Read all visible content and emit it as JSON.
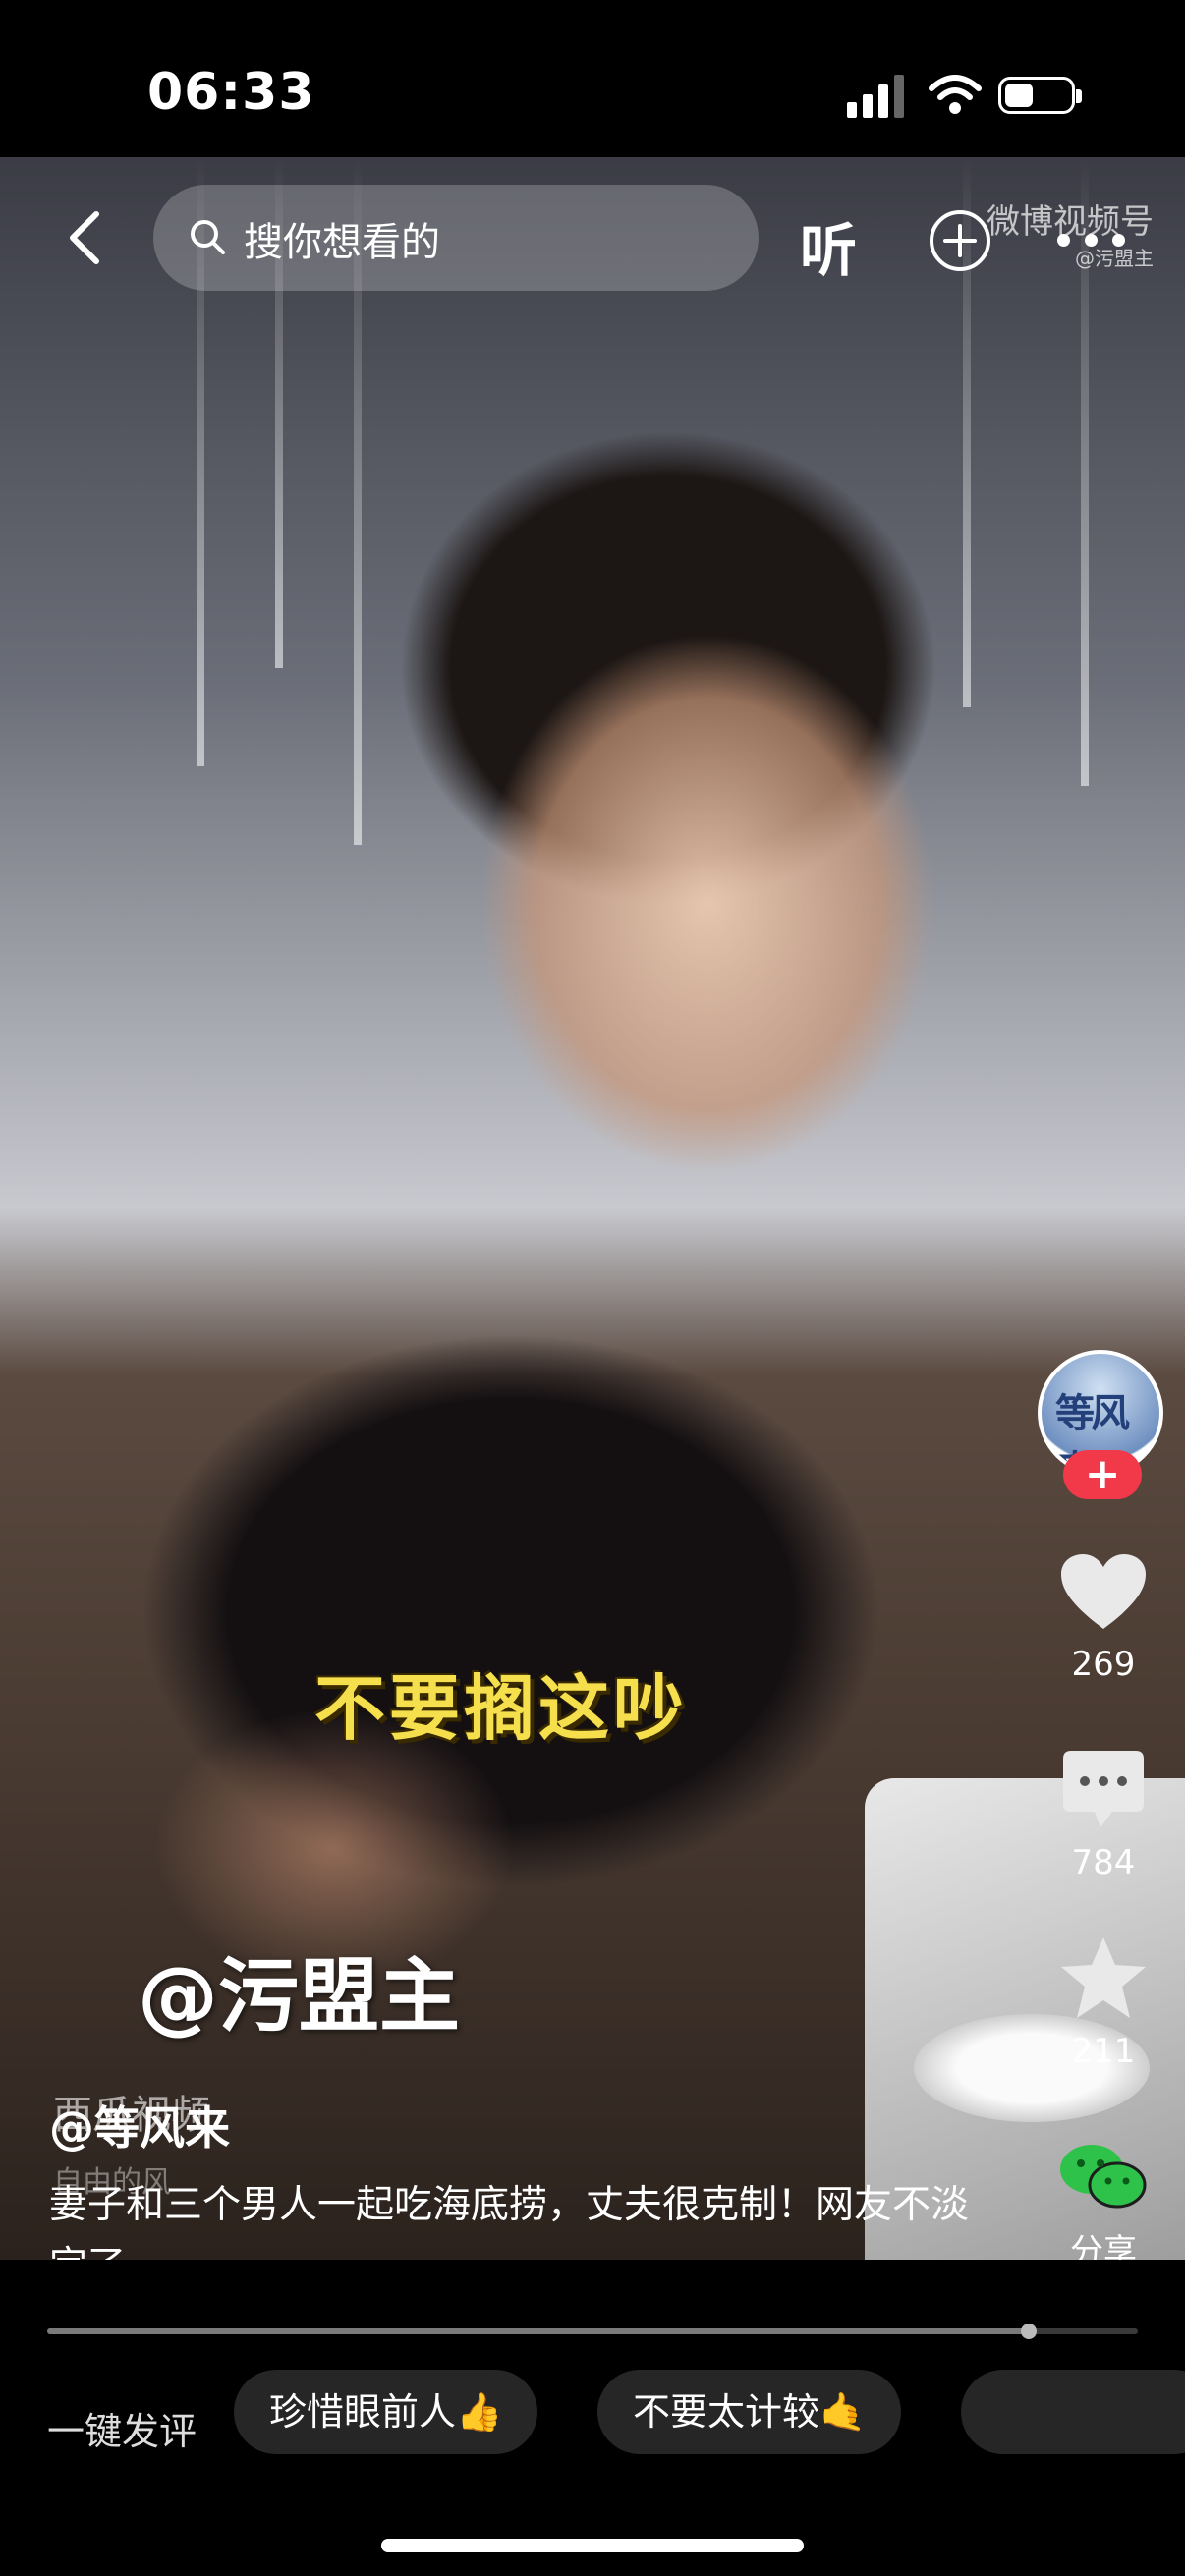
{
  "status_bar": {
    "time": "06:33"
  },
  "header": {
    "search_placeholder": "搜你想看的",
    "listen_label": "听",
    "icons": [
      "back-icon",
      "search-icon",
      "add-icon",
      "more-icon"
    ]
  },
  "video": {
    "subtitle": "不要搁这吵",
    "watermark_center": "@污盟主",
    "watermark_top_right": "微博视频号",
    "watermark_top_right_sub": "@污盟主",
    "overlay_brand": "西瓜视频",
    "overlay_sub": "自由的风"
  },
  "actions": {
    "avatar_text": "等风来",
    "follow_label": "+",
    "likes": "269",
    "comments": "784",
    "favorites": "211",
    "share_label": "分享"
  },
  "post": {
    "author": "@等风来",
    "description": "妻子和三个男人一起吃海底捞，丈夫很克制！网友不淡定了"
  },
  "playback": {
    "progress": 0.9
  },
  "quick_comment": {
    "label": "一键发评",
    "chips": [
      "珍惜眼前人👍",
      "不要太计较🤙"
    ]
  },
  "colors": {
    "accent_follow": "#f2394a",
    "subtitle": "#f5df4d",
    "share_green": "#2fc24a"
  }
}
